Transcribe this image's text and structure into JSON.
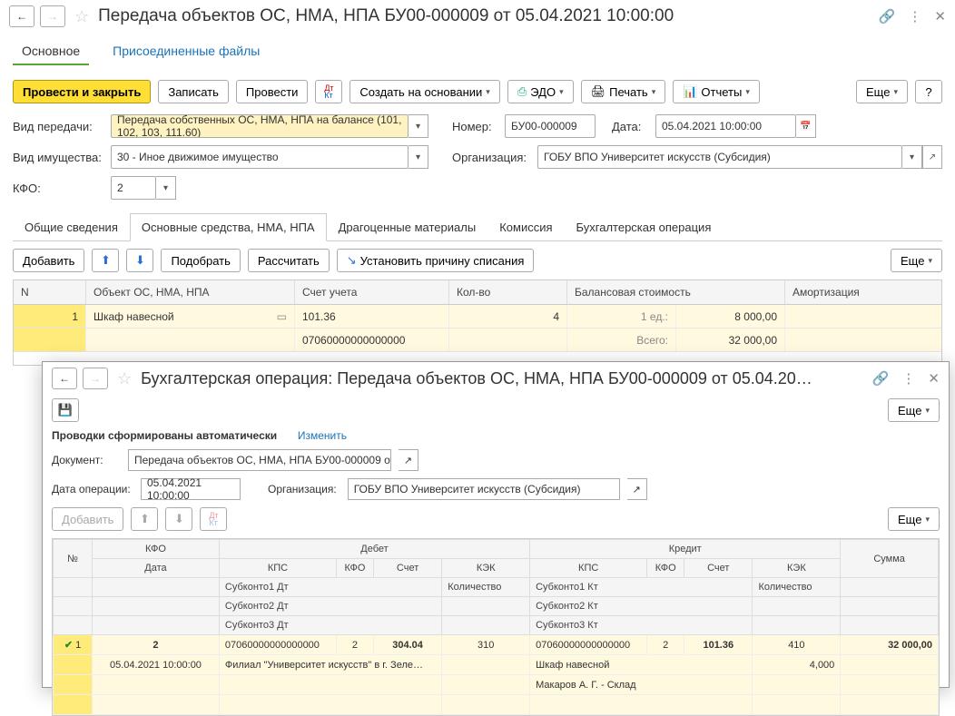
{
  "header": {
    "title": "Передача объектов ОС, НМА, НПА БУ00-000009 от 05.04.2021 10:00:00",
    "tab_main": "Основное",
    "tab_files": "Присоединенные файлы"
  },
  "toolbar": {
    "post_close": "Провести и закрыть",
    "save": "Записать",
    "post": "Провести",
    "create_based": "Создать на основании",
    "edo": "ЭДО",
    "print": "Печать",
    "reports": "Отчеты",
    "more": "Еще",
    "help": "?"
  },
  "form": {
    "l_type": "Вид передачи:",
    "v_type": "Передача собственных ОС, НМА, НПА на балансе (101, 102, 103, 111.60)",
    "l_number": "Номер:",
    "v_number": "БУ00-000009",
    "l_date": "Дата:",
    "v_date": "05.04.2021 10:00:00",
    "l_prop": "Вид имущества:",
    "v_prop": "30 - Иное движимое имущество",
    "l_org": "Организация:",
    "v_org": "ГОБУ ВПО Университет искусств (Субсидия)",
    "l_kfo": "КФО:",
    "v_kfo": "2"
  },
  "subtabs": {
    "t1": "Общие сведения",
    "t2": "Основные средства, НМА, НПА",
    "t3": "Драгоценные материалы",
    "t4": "Комиссия",
    "t5": "Бухгалтерская операция"
  },
  "tabletool": {
    "add": "Добавить",
    "pick": "Подобрать",
    "calc": "Рассчитать",
    "reason": "Установить причину списания",
    "more": "Еще"
  },
  "grid": {
    "h_n": "N",
    "h_obj": "Объект ОС, НМА, НПА",
    "h_acc": "Счет учета",
    "h_qty": "Кол-во",
    "h_bal": "Балансовая стоимость",
    "h_amort": "Амортизация",
    "r1_n": "1",
    "r1_obj": "Шкаф навесной",
    "r1_acc": "101.36",
    "r1_qty": "4",
    "r1_unit": "1 ед.:",
    "r1_cost": "8 000,00",
    "r2_kps": "07060000000000000",
    "r2_total": "Всего:",
    "r2_sum": "32 000,00"
  },
  "sub": {
    "title": "Бухгалтерская операция: Передача объектов ОС, НМА, НПА БУ00-000009 от 05.04.20…",
    "more": "Еще",
    "auto_text": "Проводки сформированы автоматически",
    "change": "Изменить",
    "l_doc": "Документ:",
    "v_doc": "Передача объектов ОС, НМА, НПА БУ00-000009 от 05.04.2021",
    "l_opdate": "Дата операции:",
    "v_opdate": "05.04.2021 10:00:00",
    "l_org": "Организация:",
    "v_org": "ГОБУ ВПО Университет искусств (Субсидия)",
    "add": "Добавить",
    "g": {
      "h_n": "№",
      "h_kfo": "КФО",
      "h_debit": "Дебет",
      "h_credit": "Кредит",
      "h_sum": "Сумма",
      "h_date": "Дата",
      "h_kps": "КПС",
      "h_kfo2": "КФО",
      "h_acc": "Счет",
      "h_kek": "КЭК",
      "h_qty": "Количество",
      "sk1d": "Субконто1 Дт",
      "sk2d": "Субконто2 Дт",
      "sk3d": "Субконто3 Дт",
      "sk1k": "Субконто1 Кт",
      "sk2k": "Субконто2 Кт",
      "sk3k": "Субконто3 Кт",
      "r_n": "1",
      "r_kfo": "2",
      "r_date": "05.04.2021 10:00:00",
      "r_kps_d": "07060000000000000",
      "r_kfo_d": "2",
      "r_acc_d": "304.04",
      "r_kek_d": "310",
      "r_kps_k": "07060000000000000",
      "r_kfo_k": "2",
      "r_acc_k": "101.36",
      "r_kek_k": "410",
      "r_sum": "32 000,00",
      "r_sk1d": "Филиал \"Университет искусств\" в г. Зеле…",
      "r_sk1k": "Шкаф навесной",
      "r_qty_k": "4,000",
      "r_sk2k": "Макаров А. Г. - Склад"
    }
  }
}
